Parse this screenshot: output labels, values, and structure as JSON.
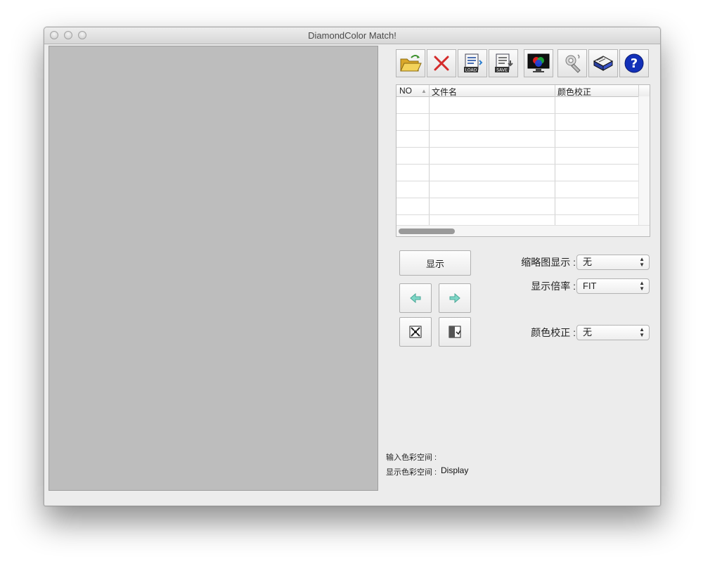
{
  "window": {
    "title": "DiamondColor Match!"
  },
  "toolbar": {
    "buttons": [
      {
        "name": "open-folder"
      },
      {
        "name": "delete"
      },
      {
        "name": "load"
      },
      {
        "name": "save"
      },
      {
        "name": "display-color"
      },
      {
        "name": "settings"
      },
      {
        "name": "manual-book"
      },
      {
        "name": "help",
        "glyph": "?"
      }
    ]
  },
  "file_table": {
    "columns": [
      "NO",
      "文件名",
      "颜色校正"
    ],
    "sort_indicator": "▲",
    "rows": []
  },
  "controls": {
    "display_button": "显示",
    "thumbnail": {
      "label": "缩略图显示 :",
      "value": "无"
    },
    "zoom": {
      "label": "显示倍率 :",
      "value": "FIT"
    },
    "color_correction": {
      "label": "颜色校正 :",
      "value": "无"
    }
  },
  "status": {
    "input_color_space_label": "输入色彩空间 :",
    "input_color_space_value": "",
    "display_color_space_label": "显示色彩空间 :",
    "display_color_space_value": "Display"
  },
  "colors": {
    "accent_red": "#d42b2b",
    "help_blue": "#1230b8",
    "folder_yellow": "#e8c23c"
  }
}
